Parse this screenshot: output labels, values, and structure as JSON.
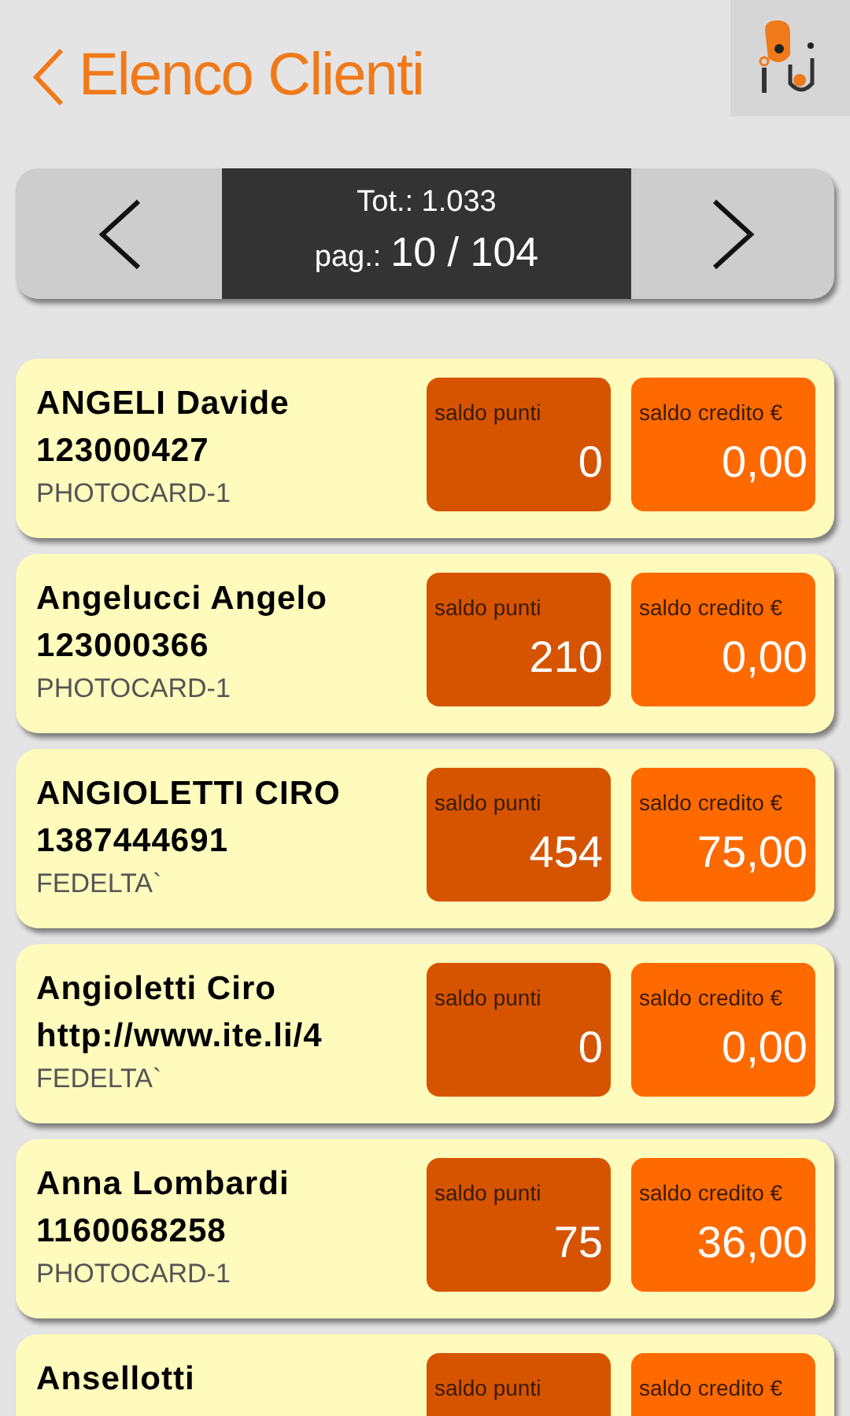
{
  "header": {
    "back_label": "Elenco Clienti"
  },
  "pager": {
    "total": "Tot.: 1.033",
    "page_label": "pag.:",
    "page": "10 / 104"
  },
  "clients": [
    {
      "name": "ANGELI Davide",
      "code": "123000427",
      "card": "PHOTOCARD-1",
      "points_label": "saldo punti",
      "points": "0",
      "credit_label": "saldo credito €",
      "credit": "0,00"
    },
    {
      "name": "Angelucci Angelo",
      "code": "123000366",
      "card": "PHOTOCARD-1",
      "points_label": "saldo punti",
      "points": "210",
      "credit_label": "saldo credito €",
      "credit": "0,00"
    },
    {
      "name": "ANGIOLETTI CIRO",
      "code": "1387444691",
      "card": "FEDELTA`",
      "points_label": "saldo punti",
      "points": "454",
      "credit_label": "saldo credito €",
      "credit": "75,00"
    },
    {
      "name": "Angioletti Ciro",
      "code": "http://www.ite.li/4",
      "card": "FEDELTA`",
      "points_label": "saldo punti",
      "points": "0",
      "credit_label": "saldo credito €",
      "credit": "0,00"
    },
    {
      "name": "Anna Lombardi",
      "code": "1160068258",
      "card": "PHOTOCARD-1",
      "points_label": "saldo punti",
      "points": "75",
      "credit_label": "saldo credito €",
      "credit": "36,00"
    },
    {
      "name": "Ansellotti",
      "points_label": "saldo punti",
      "credit_label": "saldo credito €"
    }
  ]
}
